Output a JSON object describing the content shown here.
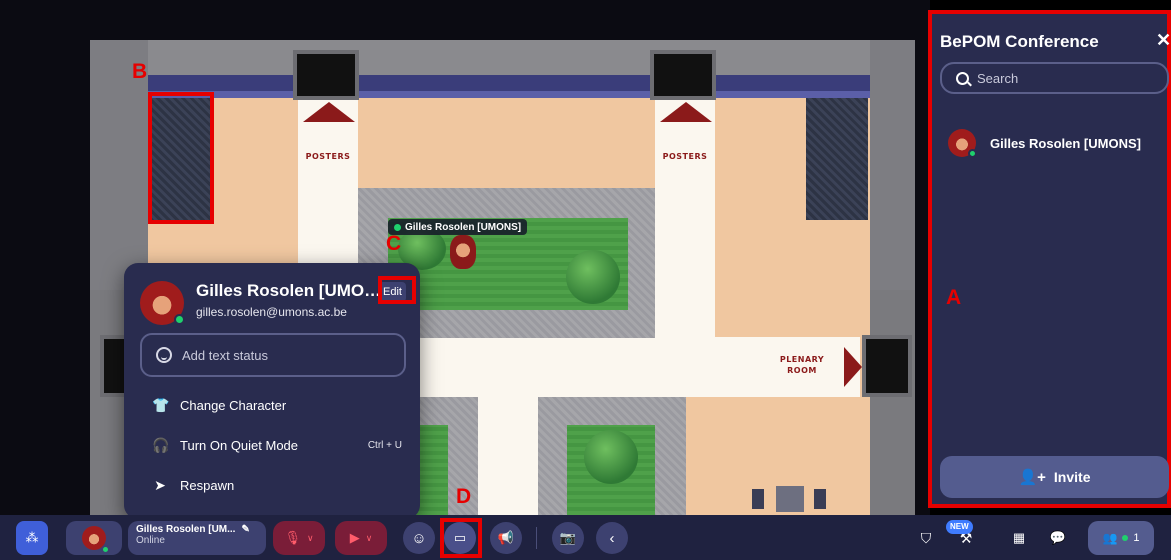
{
  "map": {
    "left_label": "POSTERS",
    "right_label": "POSTERS",
    "plenary_line1": "PLENARY",
    "plenary_line2": "ROOM",
    "player_tag": "Gilles Rosolen [UMONS]"
  },
  "annotations": {
    "a": "A",
    "b": "B",
    "c": "C",
    "d": "D",
    "color": "#e60000"
  },
  "profile_popup": {
    "name": "Gilles Rosolen [UMONS]",
    "edit_label": "Edit",
    "email": "gilles.rosolen@umons.ac.be",
    "status_placeholder": "Add text status",
    "menu": [
      {
        "label": "Change Character",
        "icon": "shirt-icon"
      },
      {
        "label": "Turn On Quiet Mode",
        "icon": "headphones-icon",
        "shortcut": "Ctrl + U"
      },
      {
        "label": "Respawn",
        "icon": "navigate-arrow-icon"
      }
    ]
  },
  "panel": {
    "title": "BePOM Conference",
    "search_placeholder": "Search",
    "users": [
      {
        "name": "Gilles Rosolen [UMONS]",
        "status": "online"
      }
    ],
    "invite_label": "Invite"
  },
  "bottom_bar": {
    "user_name": "Gilles Rosolen [UM...",
    "user_status": "Online",
    "new_badge": "NEW",
    "participant_count": "1"
  },
  "colors": {
    "panel_bg": "#292c4f",
    "bar_bg": "#1f2240",
    "online": "#1fd16d",
    "muted_red": "#7a1d38"
  }
}
